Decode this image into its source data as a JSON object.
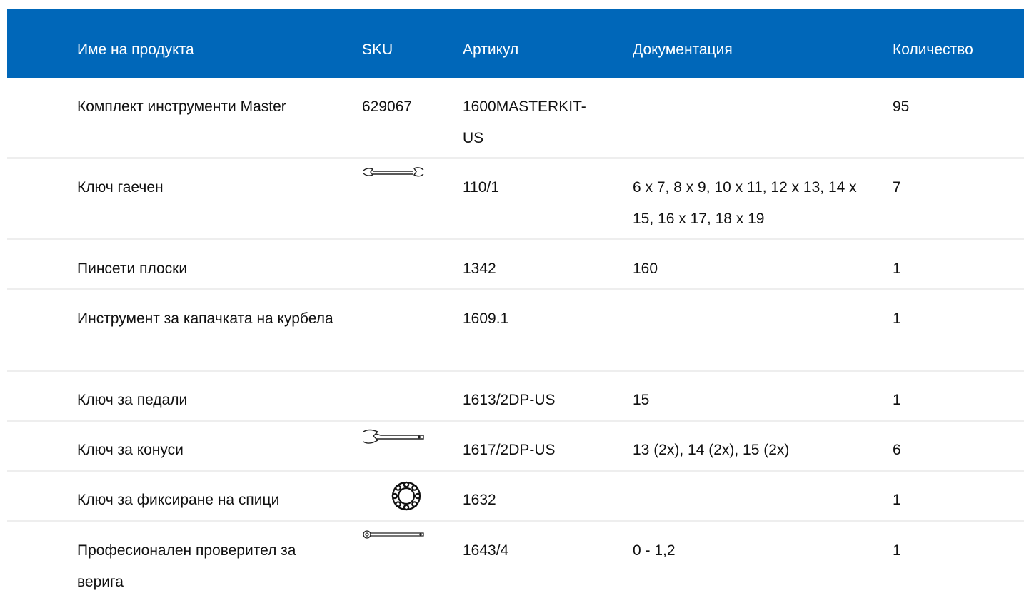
{
  "table": {
    "headers": {
      "name": "Име на продукта",
      "sku": "SKU",
      "article": "Артикул",
      "docs": "Документация",
      "qty": "Количество"
    },
    "rows": [
      {
        "name": "Комплект инструменти Master",
        "sku": "629067",
        "sku_icon": "",
        "article": "1600MASTERKIT-US",
        "docs": "",
        "qty": "95"
      },
      {
        "name": "Ключ гаечен",
        "sku": "",
        "sku_icon": "open-end-wrench-icon",
        "article": "110/1",
        "docs": "6 x 7, 8 x 9, 10 x 11, 12 x 13, 14 x 15, 16 x 17, 18 x 19",
        "qty": "7"
      },
      {
        "name": "Пинсети плоски",
        "sku": "",
        "sku_icon": "",
        "article": "1342",
        "docs": "160",
        "qty": "1"
      },
      {
        "name": "Инструмент за капачката на курбела",
        "sku": "",
        "sku_icon": "",
        "article": "1609.1",
        "docs": "",
        "qty": "1"
      },
      {
        "name": "Ключ за педали",
        "sku": "",
        "sku_icon": "",
        "article": "1613/2DP-US",
        "docs": "15",
        "qty": "1"
      },
      {
        "name": "Ключ за конуси",
        "sku": "",
        "sku_icon": "cone-wrench-icon",
        "article": "1617/2DP-US",
        "docs": "13 (2x), 14 (2x), 15 (2x)",
        "qty": "6"
      },
      {
        "name": "Ключ за фиксиране на спици",
        "sku": "",
        "sku_icon": "spoke-lock-key-icon",
        "article": "1632",
        "docs": "",
        "qty": "1"
      },
      {
        "name": "Професионален проверител за верига",
        "sku": "",
        "sku_icon": "chain-checker-icon",
        "article": "1643/4",
        "docs": "0 - 1,2",
        "qty": "1"
      }
    ]
  },
  "colors": {
    "header_bg": "#0067b9",
    "header_text": "#ffffff",
    "row_divider": "#eeeeee"
  }
}
